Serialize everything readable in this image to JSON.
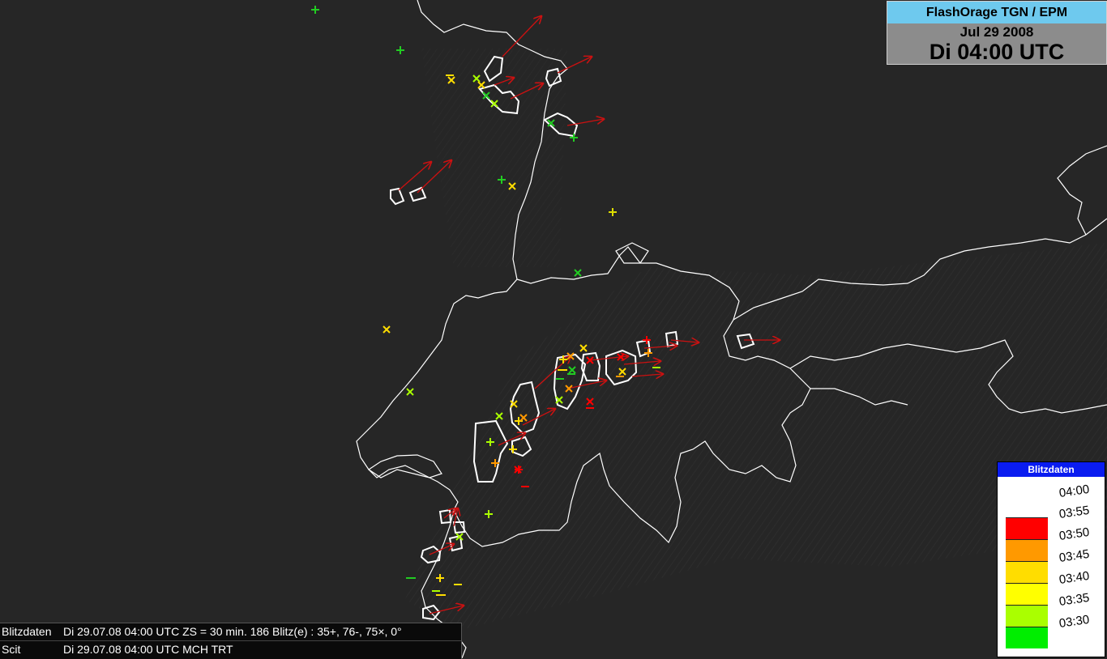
{
  "header": {
    "source": "FlashOrage TGN / EPM",
    "date": "Jul 29 2008",
    "time": "Di 04:00 UTC"
  },
  "legend": {
    "title": "Blitzdaten",
    "top_label": "04:00",
    "entries": [
      {
        "label": "03:55",
        "color": "#ff0000"
      },
      {
        "label": "03:50",
        "color": "#ff9900"
      },
      {
        "label": "03:45",
        "color": "#ffdd00"
      },
      {
        "label": "03:40",
        "color": "#ffff00"
      },
      {
        "label": "03:35",
        "color": "#aaff00"
      },
      {
        "label": "03:30",
        "color": "#00ee00"
      }
    ]
  },
  "info": {
    "row1_key": "Blitzdaten",
    "row1_value": "Di 29.07.08 04:00 UTC  ZS = 30 min. 186 Blitz(e) : 35+, 76-, 75×, 0°",
    "row2_key": "Scit",
    "row2_value": "Di 29.07.08 04:00 UTC  MCH TRT"
  },
  "colors": {
    "background": "#262626",
    "border": "#ffffff",
    "cell_outline": "#ffffff",
    "track_arrow": "#cc1111"
  }
}
